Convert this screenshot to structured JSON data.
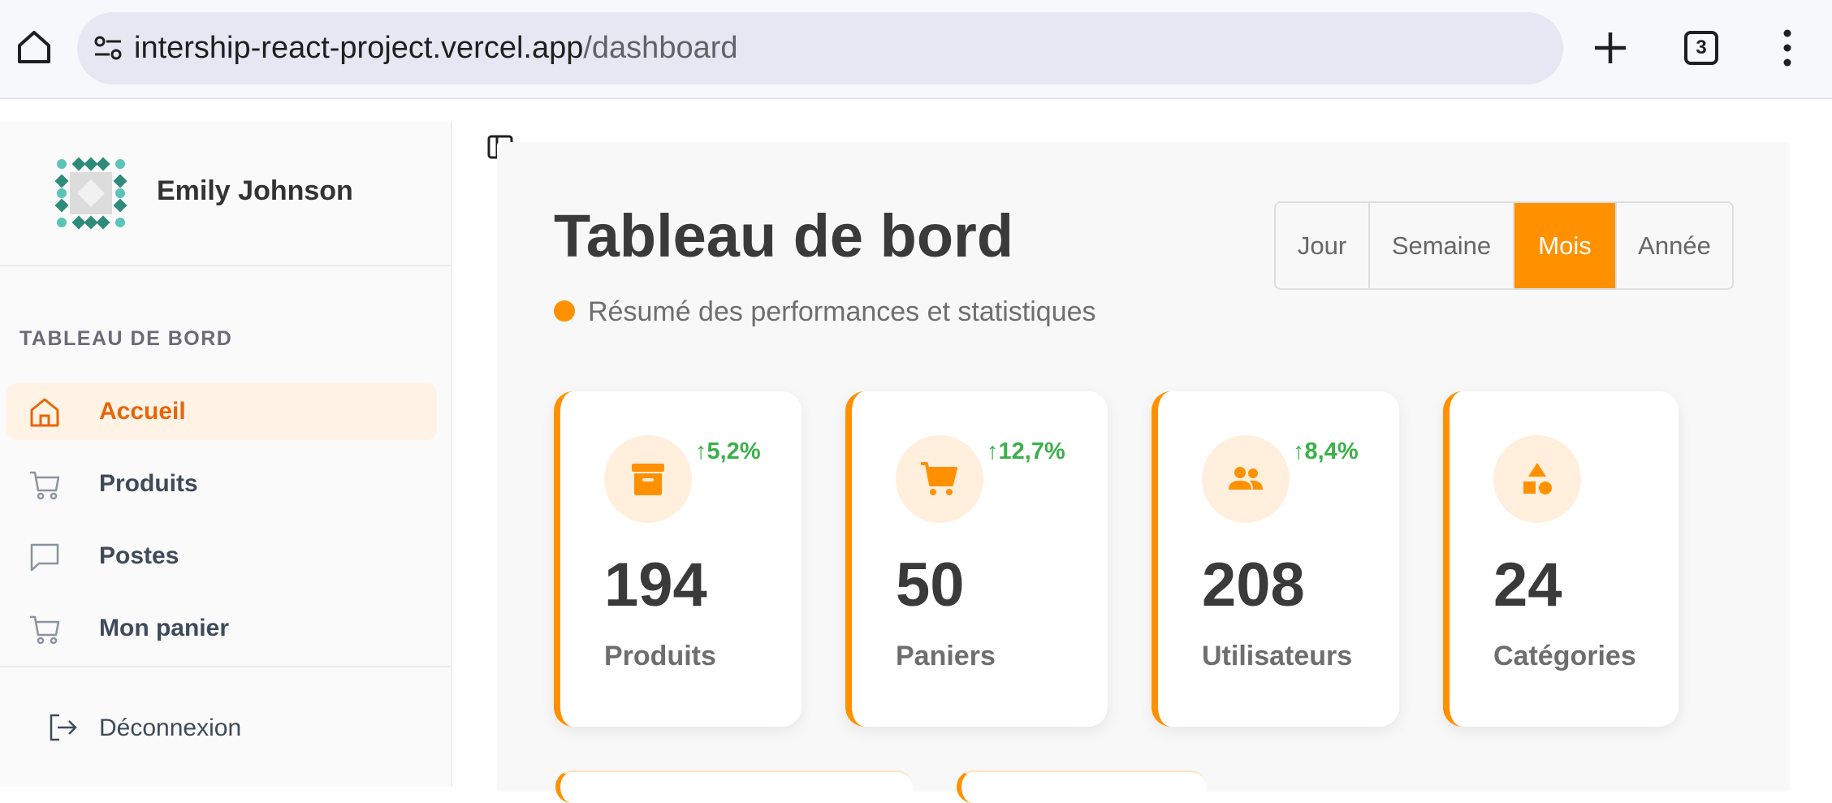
{
  "browser": {
    "url_host": "intership-react-project.vercel.app",
    "url_path": "/dashboard",
    "tab_count": "3"
  },
  "sidebar": {
    "user_name": "Emily Johnson",
    "section_title": "TABLEAU DE BORD",
    "items": [
      {
        "label": "Accueil",
        "icon": "home-icon",
        "active": true
      },
      {
        "label": "Produits",
        "icon": "cart-icon",
        "active": false
      },
      {
        "label": "Postes",
        "icon": "message-icon",
        "active": false
      },
      {
        "label": "Mon panier",
        "icon": "cart-icon",
        "active": false
      }
    ],
    "logout_label": "Déconnexion"
  },
  "main": {
    "title": "Tableau de bord",
    "subtitle": "Résumé des performances et statistiques",
    "periods": [
      "Jour",
      "Semaine",
      "Mois",
      "Année"
    ],
    "active_period": "Mois",
    "cards": [
      {
        "value": "194",
        "label": "Produits",
        "trend": "↑5,2%",
        "icon": "archive-box-icon"
      },
      {
        "value": "50",
        "label": "Paniers",
        "trend": "↑12,7%",
        "icon": "shopping-cart-icon"
      },
      {
        "value": "208",
        "label": "Utilisateurs",
        "trend": "↑8,4%",
        "icon": "users-icon"
      },
      {
        "value": "24",
        "label": "Catégories",
        "trend": "",
        "icon": "shapes-icon"
      }
    ]
  },
  "colors": {
    "accent": "#ff9100",
    "active_nav_text": "#e8650a",
    "trend_up": "#3bb04a"
  }
}
